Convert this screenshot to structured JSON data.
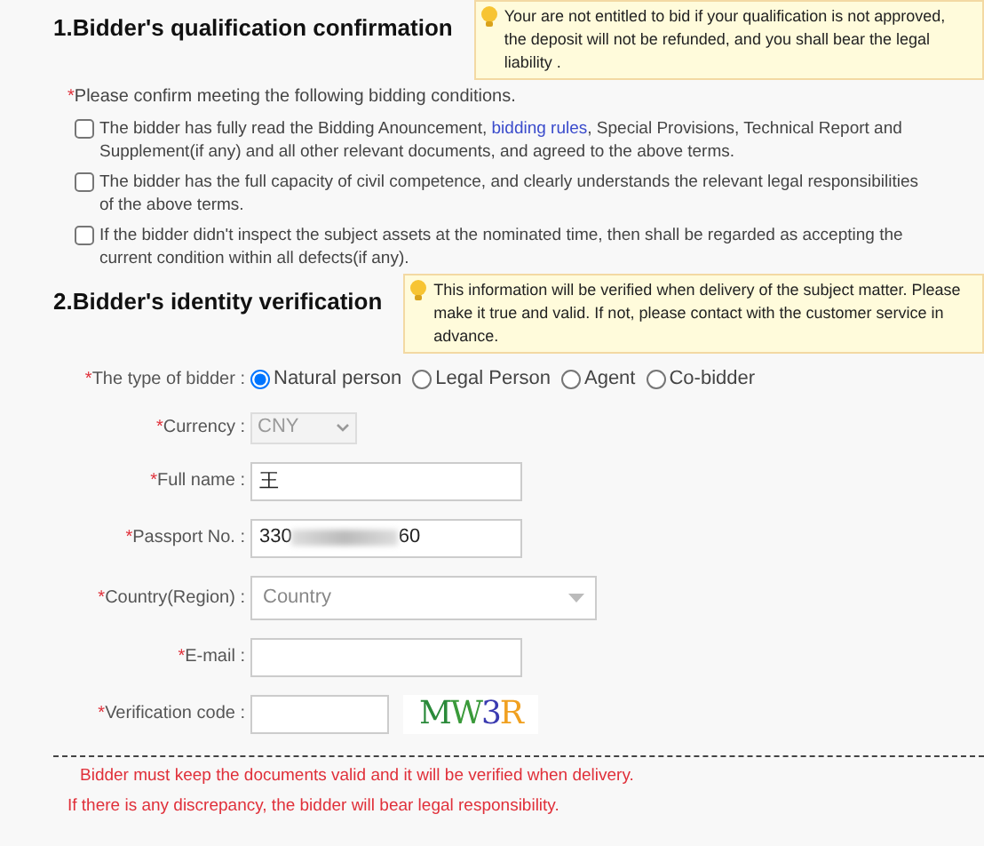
{
  "sections": [
    {
      "title": "1.Bidder's qualification confirmation",
      "notice": "Your are not entitled to bid if your qualification is not approved, the deposit will not be refunded, and you shall bear the legal liability ."
    },
    {
      "title": "2.Bidder's identity verification",
      "notice": "This information will be verified when delivery of the subject matter. Please make it true and valid. If not, please contact with the customer service in advance."
    }
  ],
  "conditions_prompt_mark": "*",
  "conditions_prompt": "Please confirm meeting the following bidding conditions.",
  "conditions": [
    {
      "before": "The bidder has fully read the Bidding Anouncement, ",
      "link": "bidding rules",
      "after": ", Special Provisions, Technical Report and Supplement(if any) and all other relevant documents, and agreed to the above terms.",
      "checked": false
    },
    {
      "before": "The bidder has the full capacity of civil competence, and clearly understands the relevant legal responsibilities of the above terms.",
      "checked": false
    },
    {
      "before": "If the bidder didn't inspect the subject assets at the nominated time, then shall be regarded as accepting the current condition within all defects(if any).",
      "checked": false
    }
  ],
  "form": [
    {
      "kind": "radio",
      "mark": "*",
      "label": "The type of bidder :",
      "options": [
        {
          "label": "Natural person",
          "selected": true
        },
        {
          "label": "Legal Person",
          "selected": false
        },
        {
          "label": "Agent",
          "selected": false
        },
        {
          "label": "Co-bidder",
          "selected": false
        }
      ]
    },
    {
      "kind": "select",
      "mark": "*",
      "label": "Currency :",
      "value": "CNY",
      "disabled": true
    },
    {
      "kind": "text",
      "mark": "*",
      "label": "Full name :",
      "value": "王"
    },
    {
      "kind": "redacted",
      "mark": "*",
      "label": "Passport No. :",
      "value_start": "330",
      "value_end": "60"
    },
    {
      "kind": "dropdown",
      "mark": "*",
      "label": "Country(Region) :",
      "placeholder": "Country"
    },
    {
      "kind": "text",
      "mark": "*",
      "label": "E-mail :"
    },
    {
      "kind": "captcha",
      "mark": "*",
      "label": "Verification code :",
      "captcha": "MW3R"
    }
  ],
  "footer_notes": [
    "Bidder must keep the documents valid and it will be verified when delivery.",
    "If there is any discrepancy, the bidder will bear legal responsibility."
  ]
}
